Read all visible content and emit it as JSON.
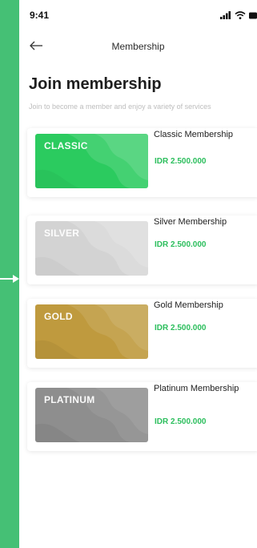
{
  "status_bar": {
    "time": "9:41",
    "icons": [
      "signal-icon",
      "wifi-icon",
      "battery-icon"
    ]
  },
  "header": {
    "back_icon": "arrow-left-icon",
    "title": "Membership"
  },
  "page": {
    "title": "Join membership",
    "subtitle": "Join to become a member and enjoy a variety of services"
  },
  "memberships": [
    {
      "tier": "CLASSIC",
      "name": "Classic Membership",
      "price": "IDR 2.500.000",
      "color": "#2BCB5F"
    },
    {
      "tier": "SILVER",
      "name": "Silver Membership",
      "price": "IDR 2.500.000",
      "color": "#D3D3D3"
    },
    {
      "tier": "GOLD",
      "name": "Gold Membership",
      "price": "IDR 2.500.000",
      "color": "#BF9A3E"
    },
    {
      "tier": "PLATINUM",
      "name": "Platinum Membership",
      "price": "IDR 2.500.000",
      "color": "#8E8E8E"
    }
  ],
  "colors": {
    "background": "#45C075",
    "price": "#2BBE5C"
  }
}
